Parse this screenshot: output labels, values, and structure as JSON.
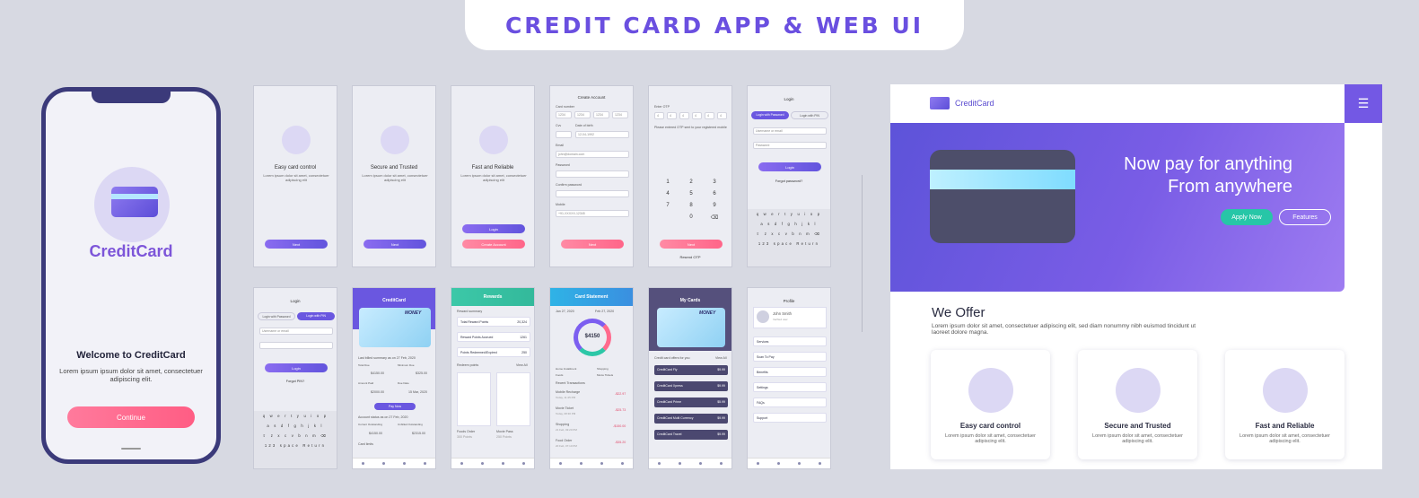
{
  "banner": {
    "title": "CREDIT CARD APP & WEB UI"
  },
  "phone": {
    "brand": "CreditCard",
    "welcome": "Welcome to CreditCard",
    "lorem": "Lorem ipsum ipsum dolor sit amet, consectetuer adipiscing elit.",
    "continue_label": "Continue"
  },
  "onboarding": [
    {
      "title": "Easy card control",
      "desc": "Lorem ipsum dolor sit amet, consectetuer adipiscing elit",
      "button": "Next"
    },
    {
      "title": "Secure and Trusted",
      "desc": "Lorem ipsum dolor sit amet, consectetuer adipiscing elit",
      "button": "Next"
    },
    {
      "title": "Fast and Reliable",
      "desc": "Lorem ipsum dolor sit amet, consectetuer adipiscing elit",
      "button": "Login",
      "button2": "Create Account"
    }
  ],
  "create_account": {
    "title": "Create Account",
    "card_number_label": "Card number",
    "card_number": [
      "1234",
      "1234",
      "1234",
      "1234"
    ],
    "cvv_label": "Cvv",
    "dob_label": "Date of birth",
    "dob": "12-04-1992",
    "email_label": "Email",
    "email": "john@domain.com",
    "password_label": "Password",
    "confirm_label": "Confirm password",
    "mobile_label": "Mobile",
    "mobile": "+91-XXXXX-12345",
    "button": "Next"
  },
  "otp": {
    "label": "Enter OTP",
    "digits": [
      "4",
      "4",
      "4",
      "4",
      "4",
      "4"
    ],
    "note": "Please entered OTP sent to your registered mobile",
    "keys": [
      "1",
      "2",
      "3",
      "4",
      "5",
      "6",
      "7",
      "8",
      "9",
      "",
      "0",
      "⌫"
    ],
    "button": "Next",
    "resend": "Resend OTP"
  },
  "login": {
    "title": "Login",
    "tab_password": "Login with Password",
    "tab_pin": "Login with PIN",
    "username_placeholder": "Username or email",
    "password_placeholder": "Password",
    "button": "Login",
    "forgot": "Forgot password?",
    "forgot_pin": "Forgot PIN?",
    "keyboard": [
      "q w e r t y u i o p",
      "a s d f g h j k l",
      "⇧ z x c v b n m ⌫",
      "123  space  Return"
    ]
  },
  "creditcard_screen": {
    "title": "CreditCard",
    "card_brand": "MONEY",
    "last_billed": "Last billed summary as on 27 Feb, 2020",
    "total_due_label": "Total Due",
    "total_due": "$4150.00",
    "minimum_due_label": "Minimum Due",
    "minimum_due": "$325.00",
    "amount_paid_label": "Amount Paid",
    "amount_paid": "$2000.00",
    "due_date_label": "Due Date",
    "due_date": "15 Mar, 2020",
    "pay_now": "Pay Now",
    "account_status": "Account status as on 27 Feb, 2020",
    "current_outstanding_label": "Current Outstanding",
    "current_outstanding": "$4150.00",
    "unbilled_label": "Unbilled Outstanding",
    "unbilled": "$2315.00",
    "card_limits": "Card limits"
  },
  "rewards": {
    "title": "Rewards",
    "summary_label": "Reward summary",
    "rows": [
      {
        "label": "Total Reward Points",
        "value": "20,324"
      },
      {
        "label": "Reward Points Accrued",
        "value": "1261"
      },
      {
        "label": "Points Redeemed/Expired",
        "value": "250"
      }
    ],
    "redeem_label": "Redeem points",
    "view_all": "View All",
    "items": [
      {
        "name": "Foods Order",
        "pts": "300 Points"
      },
      {
        "name": "Movie Pass",
        "pts": "250 Points"
      }
    ]
  },
  "statement": {
    "title": "Card Statement",
    "from": "Jan 27, 2020",
    "to": "Feb 27, 2020",
    "total": "$4150",
    "total_label": "Total",
    "legend": [
      "Home Installment",
      "Shopping",
      "Foods",
      "Movie Tickets"
    ],
    "recent_label": "Recent Transactions",
    "transactions": [
      {
        "name": "Mobile Recharge",
        "date": "Today, 11:45 PM",
        "amount": "-$22.97"
      },
      {
        "name": "Movie Ticket",
        "date": "Today, 08:30 PM",
        "amount": "-$25.73"
      },
      {
        "name": "Shopping",
        "date": "21 Feb, 03:20 PM",
        "amount": "-$150.00"
      },
      {
        "name": "Food Order",
        "date": "20 Feb, 07:10 PM",
        "amount": "-$35.20"
      }
    ]
  },
  "my_cards": {
    "title": "My Cards",
    "card_brand": "MONEY",
    "offers_label": "Credit card offers for you",
    "view_all": "View All",
    "offers": [
      {
        "name": "CreditCard Fly",
        "price": "$9.99"
      },
      {
        "name": "CreditCard Xpress",
        "price": "$9.99"
      },
      {
        "name": "CreditCard Prime",
        "price": "$5.99"
      },
      {
        "name": "CreditCard Multi Currency",
        "price": "$9.99"
      },
      {
        "name": "CreditCard Travel",
        "price": "$9.99"
      }
    ]
  },
  "profile": {
    "title": "Profile",
    "name": "John Smith",
    "status": "Verified user",
    "menu": [
      "Services",
      "Scan To Pay",
      "Benefits",
      "Settings",
      "FAQs",
      "Support"
    ]
  },
  "nav": [
    "Dashboard",
    "Rewards",
    "Offers",
    "Profile"
  ],
  "web": {
    "brand": "CreditCard",
    "headline1": "Now pay for anything",
    "headline2": "From anywhere",
    "apply_now": "Apply Now",
    "features": "Features",
    "we_offer": "We Offer",
    "we_offer_text": "Lorem ipsum dolor sit amet, consectetuer adipiscing elit, sed diam nonummy nibh euismod tincidunt ut laoreet dolore magna.",
    "cards": [
      {
        "title": "Easy card control",
        "text": "Lorem ipsum dolor sit amet, consectetuer adipiscing elit."
      },
      {
        "title": "Secure and Trusted",
        "text": "Lorem ipsum dolor sit amet, consectetuer adipiscing elit."
      },
      {
        "title": "Fast and Reliable",
        "text": "Lorem ipsum dolor sit amet, consectetuer adipiscing elit."
      }
    ]
  },
  "colors": {
    "primary": "#6a4fe0",
    "pink": "#ff6589",
    "teal": "#27c6a7",
    "navy": "#3b3a7a"
  }
}
